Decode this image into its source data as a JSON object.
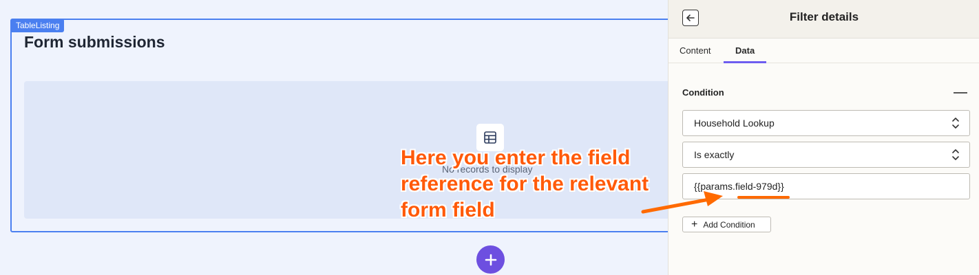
{
  "canvas": {
    "component_tag": "TableListing",
    "page_title": "Form submissions",
    "empty_text": "No records to display"
  },
  "annotation": {
    "lines": [
      "Here you enter the field",
      "reference for the relevant",
      "form field"
    ]
  },
  "panel": {
    "title": "Filter details",
    "tabs": [
      {
        "label": "Content",
        "active": false
      },
      {
        "label": "Data",
        "active": true
      }
    ],
    "condition_label": "Condition",
    "field_select": "Household Lookup",
    "operator_select": "Is exactly",
    "value_input": "{{params.field-979d}}",
    "add_condition_label": "Add Condition"
  },
  "colors": {
    "accent": "#6d4fe0",
    "tag_blue": "#4a7ff0",
    "annotation": "#ff5a0a",
    "tab_underline": "#6d5df0"
  },
  "icons": [
    "table-icon",
    "plus-icon",
    "back-arrow-icon",
    "collapse-icon",
    "chevron-updown-icon"
  ]
}
